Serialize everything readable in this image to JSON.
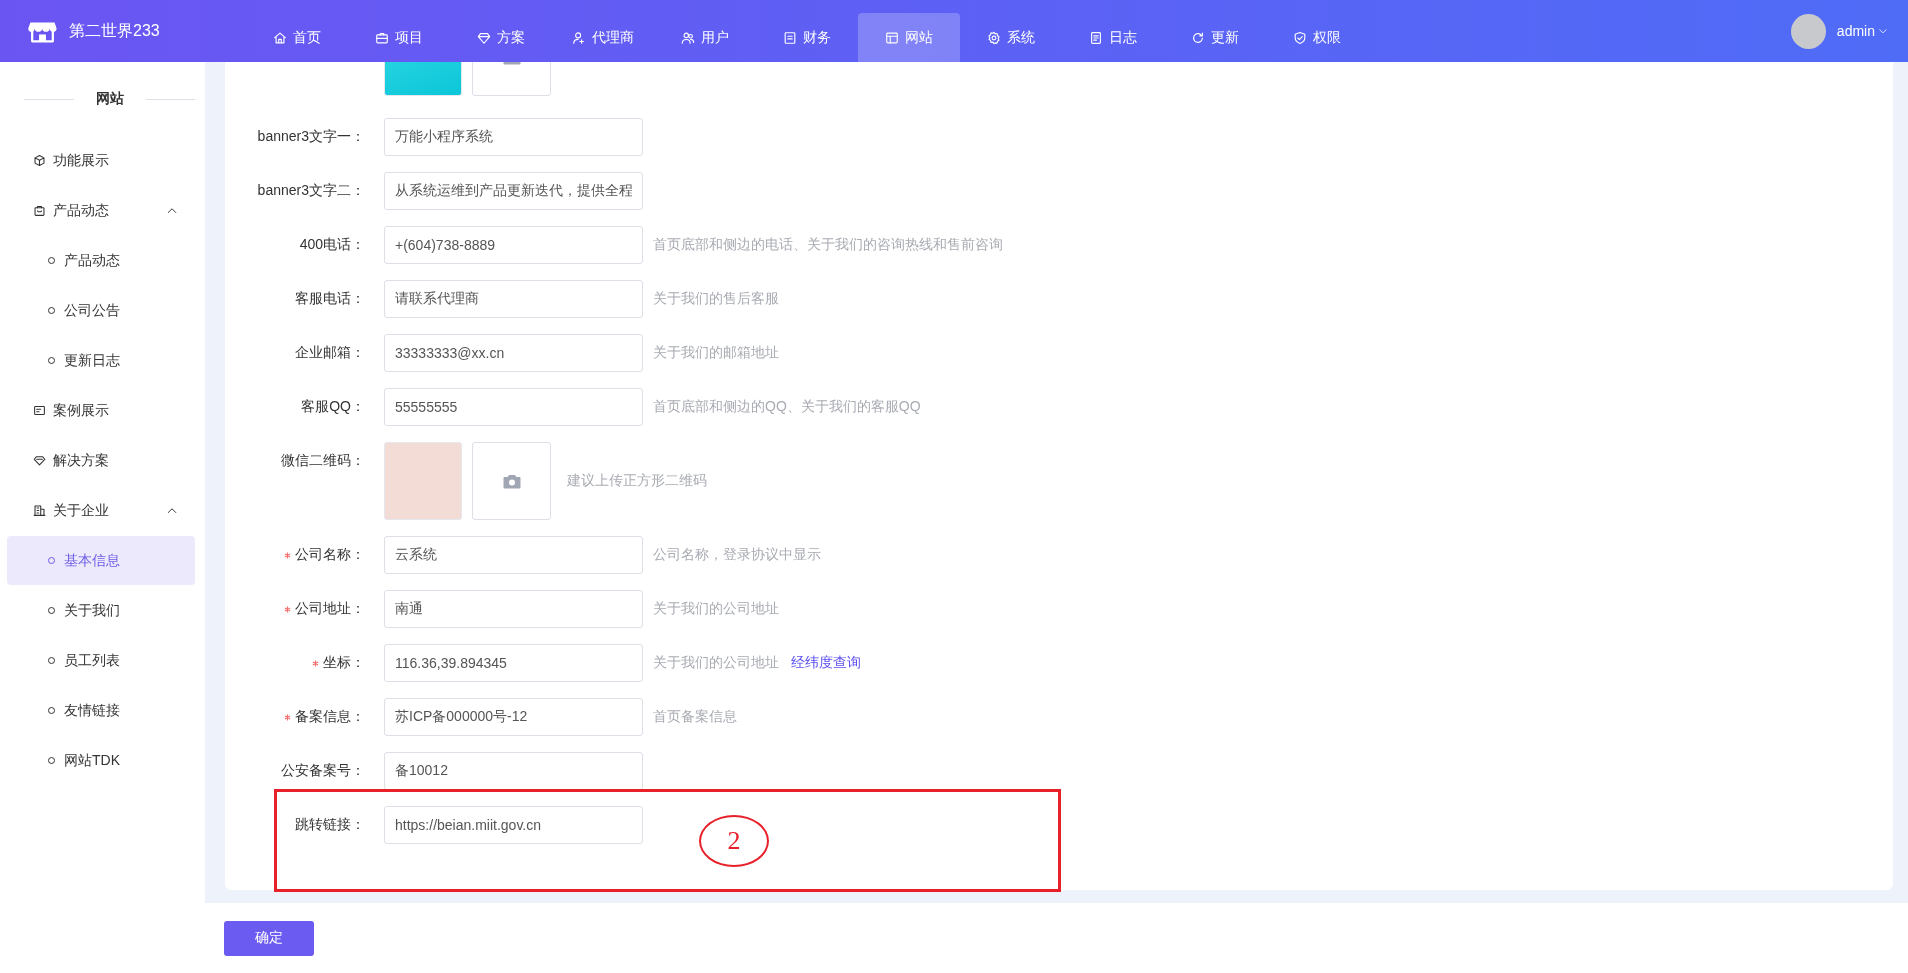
{
  "brand": {
    "name": "第二世界233"
  },
  "nav": [
    {
      "label": "首页",
      "selected": false
    },
    {
      "label": "项目",
      "selected": false
    },
    {
      "label": "方案",
      "selected": false
    },
    {
      "label": "代理商",
      "selected": false
    },
    {
      "label": "用户",
      "selected": false
    },
    {
      "label": "财务",
      "selected": false
    },
    {
      "label": "网站",
      "selected": true
    },
    {
      "label": "系统",
      "selected": false
    },
    {
      "label": "日志",
      "selected": false
    },
    {
      "label": "更新",
      "selected": false
    },
    {
      "label": "权限",
      "selected": false
    }
  ],
  "user": {
    "name": "admin"
  },
  "sidebar": {
    "title": "网站",
    "items": [
      {
        "label": "功能展示",
        "selected": false
      },
      {
        "label": "产品动态",
        "expanded": true,
        "children": [
          {
            "label": "产品动态",
            "selected": false
          },
          {
            "label": "公司公告",
            "selected": false
          },
          {
            "label": "更新日志",
            "selected": false
          }
        ]
      },
      {
        "label": "案例展示",
        "selected": false
      },
      {
        "label": "解决方案",
        "selected": false
      },
      {
        "label": "关于企业",
        "expanded": true,
        "children": [
          {
            "label": "基本信息",
            "selected": true
          },
          {
            "label": "关于我们",
            "selected": false
          },
          {
            "label": "员工列表",
            "selected": false
          },
          {
            "label": "友情链接",
            "selected": false
          },
          {
            "label": "网站TDK",
            "selected": false
          }
        ]
      }
    ]
  },
  "form": {
    "rows": [
      {
        "kind": "upload"
      },
      {
        "kind": "text",
        "label": "banner3文字一：",
        "required": false,
        "value": "万能小程序系统"
      },
      {
        "kind": "text",
        "label": "banner3文字二：",
        "required": false,
        "value": "从系统运维到产品更新迭代，提供全程"
      },
      {
        "kind": "text",
        "label": "400电话：",
        "required": false,
        "value": "+(604)738-8889",
        "hint": "首页底部和侧边的电话、关于我们的咨询热线和售前咨询"
      },
      {
        "kind": "text",
        "label": "客服电话：",
        "required": false,
        "value": "请联系代理商",
        "hint": "关于我们的售后客服"
      },
      {
        "kind": "text",
        "label": "企业邮箱：",
        "required": false,
        "value": "33333333@xx.cn",
        "hint": "关于我们的邮箱地址"
      },
      {
        "kind": "text",
        "label": "客服QQ：",
        "required": false,
        "value": "55555555",
        "hint": "首页底部和侧边的QQ、关于我们的客服QQ"
      },
      {
        "kind": "upload",
        "label": "微信二维码：",
        "required": false,
        "hint": "建议上传正方形二维码"
      },
      {
        "kind": "text",
        "label": "公司名称：",
        "required": true,
        "value": "云系统",
        "hint": "公司名称，登录协议中显示"
      },
      {
        "kind": "text",
        "label": "公司地址：",
        "required": true,
        "value": "南通",
        "hint": "关于我们的公司地址"
      },
      {
        "kind": "text",
        "label": "坐标：",
        "required": true,
        "value": "116.36,39.894345",
        "hint": "关于我们的公司地址",
        "link": "经纬度查询"
      },
      {
        "kind": "text",
        "label": "备案信息：",
        "required": true,
        "value": "苏ICP备000000号-12",
        "hint": "首页备案信息"
      },
      {
        "kind": "text",
        "label": "公安备案号：",
        "required": false,
        "value": "备10012"
      },
      {
        "kind": "text",
        "label": "跳转链接：",
        "required": false,
        "value": "https://beian.miit.gov.cn"
      }
    ]
  },
  "submit": {
    "label": "确定"
  },
  "annotation": {
    "label": "2"
  }
}
